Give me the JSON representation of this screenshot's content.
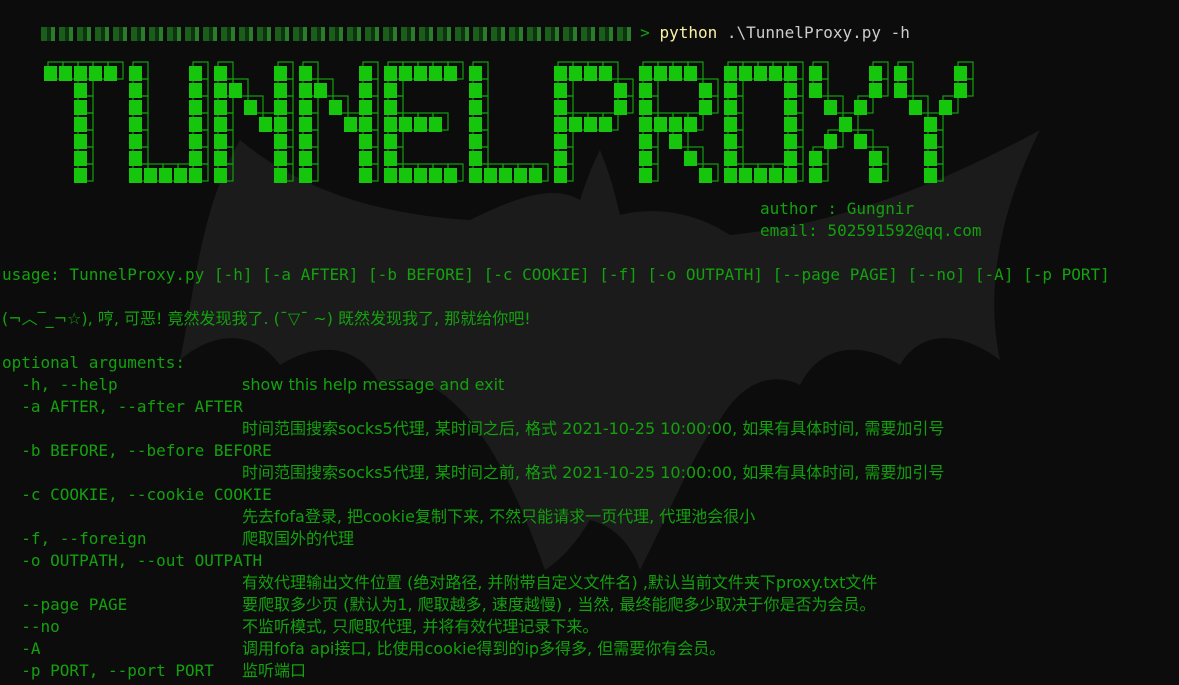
{
  "prompt": {
    "command": "python",
    "script": ".\\TunnelProxy.py",
    "flag": "-h"
  },
  "banner": {
    "title": "TUNNELPROXY",
    "author": "author : Gungnir",
    "email": "email: 502591592@qq.com"
  },
  "usage": "usage: TunnelProxy.py [-h] [-a AFTER] [-b BEFORE] [-c COOKIE] [-f] [-o OUTPATH] [--page PAGE] [--no] [-A] [-p PORT]",
  "description": "(¬︿‾_¬☆), 哼, 可恶! 竟然发现我了. (¯▽¯ ~) 既然发现我了, 那就给你吧!",
  "options_header": "optional arguments:",
  "options": [
    {
      "flags": "  -h, --help",
      "help": "show this help message and exit"
    },
    {
      "flags": "  -a AFTER, --after AFTER",
      "help": ""
    },
    {
      "flags": "",
      "help": "时间范围搜索socks5代理, 某时间之后, 格式 2021-10-25 10:00:00, 如果有具体时间, 需要加引号"
    },
    {
      "flags": "  -b BEFORE, --before BEFORE",
      "help": ""
    },
    {
      "flags": "",
      "help": "时间范围搜索socks5代理, 某时间之前, 格式 2021-10-25 10:00:00, 如果有具体时间, 需要加引号"
    },
    {
      "flags": "  -c COOKIE, --cookie COOKIE",
      "help": ""
    },
    {
      "flags": "",
      "help": "先去fofa登录, 把cookie复制下来, 不然只能请求一页代理, 代理池会很小"
    },
    {
      "flags": "  -f, --foreign",
      "help": "爬取国外的代理"
    },
    {
      "flags": "  -o OUTPATH, --out OUTPATH",
      "help": ""
    },
    {
      "flags": "",
      "help": "有效代理输出文件位置 (绝对路径, 并附带自定义文件名) ,默认当前文件夹下proxy.txt文件"
    },
    {
      "flags": "  --page PAGE",
      "help": "要爬取多少页 (默认为1, 爬取越多, 速度越慢) , 当然, 最终能爬多少取决于你是否为会员。"
    },
    {
      "flags": "  --no",
      "help": "不监听模式, 只爬取代理, 并将有效代理记录下来。"
    },
    {
      "flags": "  -A",
      "help": "调用fofa api接口, 比使用cookie得到的ip多得多, 但需要你有会员。"
    },
    {
      "flags": "  -p PORT, --port PORT",
      "help": "监听端口"
    }
  ],
  "colors": {
    "background": "#0c0c0c",
    "text_green": "#13a10e",
    "banner_green": "#16c60c",
    "command_yellow": "#f9f1a5",
    "command_gray": "#cccccc"
  }
}
